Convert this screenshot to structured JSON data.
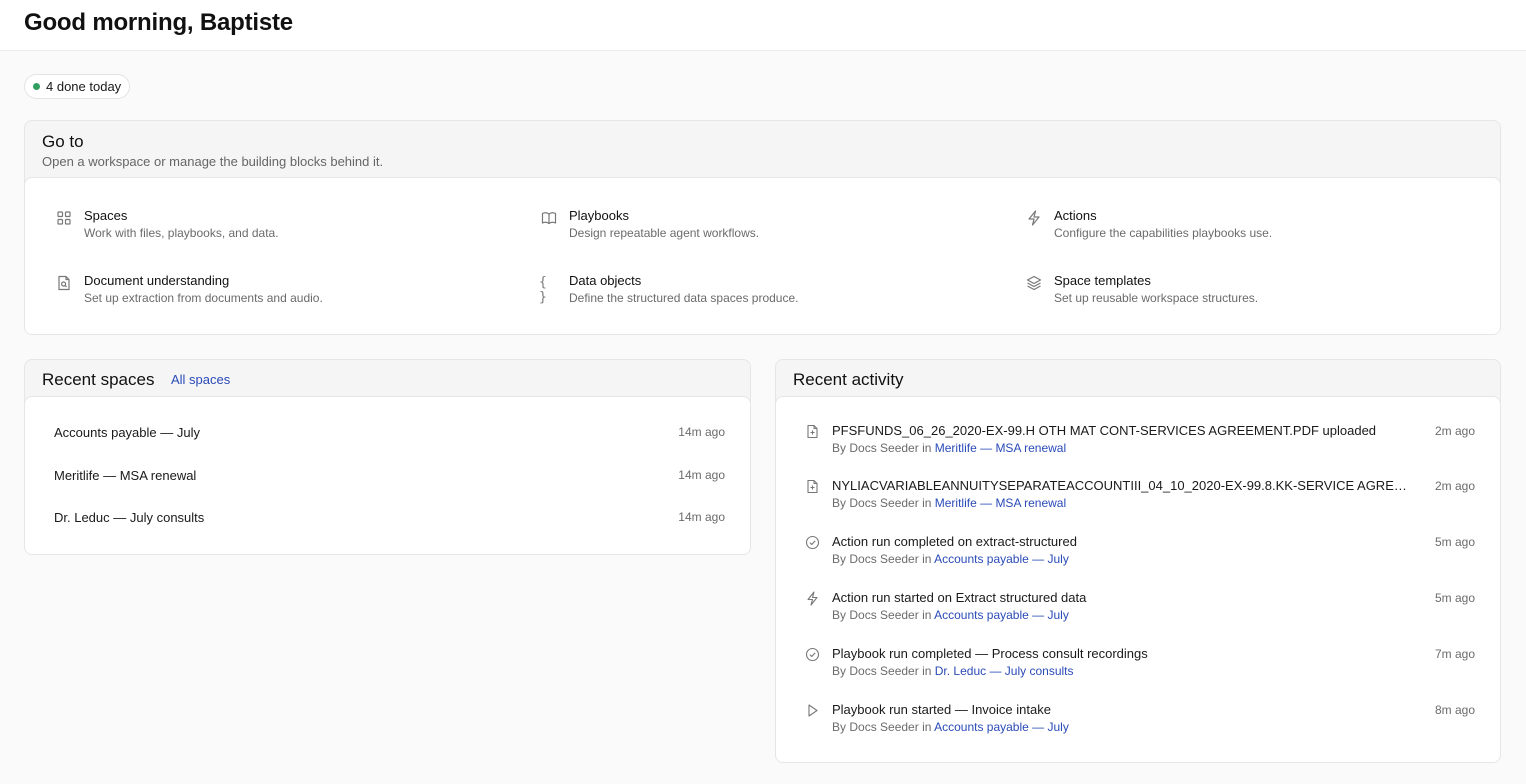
{
  "header": {
    "greeting": "Good morning, Baptiste"
  },
  "status": {
    "text": "4 done today",
    "dot_color": "#2f9e5f"
  },
  "goto": {
    "title": "Go to",
    "subtitle": "Open a workspace or manage the building blocks behind it.",
    "items": [
      {
        "label": "Spaces",
        "description": "Work with files, playbooks, and data.",
        "icon": "grid-icon"
      },
      {
        "label": "Playbooks",
        "description": "Design repeatable agent workflows.",
        "icon": "book-icon"
      },
      {
        "label": "Actions",
        "description": "Configure the capabilities playbooks use.",
        "icon": "lightning-icon"
      },
      {
        "label": "Document understanding",
        "description": "Set up extraction from documents and audio.",
        "icon": "document-search-icon"
      },
      {
        "label": "Data objects",
        "description": "Define the structured data spaces produce.",
        "icon": "braces-icon",
        "glyph": "{ }"
      },
      {
        "label": "Space templates",
        "description": "Set up reusable workspace structures.",
        "icon": "layers-icon"
      }
    ]
  },
  "recent_spaces": {
    "title": "Recent spaces",
    "all_link": "All spaces",
    "items": [
      {
        "name": "Accounts payable — July",
        "time": "14m ago"
      },
      {
        "name": "Meritlife — MSA renewal",
        "time": "14m ago"
      },
      {
        "name": "Dr. Leduc — July consults",
        "time": "14m ago"
      }
    ]
  },
  "recent_activity": {
    "title": "Recent activity",
    "by_prefix": "By",
    "in_word": "in",
    "items": [
      {
        "icon": "file-icon",
        "title": "PFSFUNDS_06_26_2020-EX-99.H OTH MAT CONT-SERVICES AGREEMENT.PDF uploaded",
        "author": "Docs Seeder",
        "space": "Meritlife — MSA renewal",
        "time": "2m ago"
      },
      {
        "icon": "file-icon",
        "title": "NYLIACVARIABLEANNUITYSEPARATEACCOUNTIII_04_10_2020-EX-99.8.KK-SERVICE AGREEMENT.PDF uploaded",
        "author": "Docs Seeder",
        "space": "Meritlife — MSA renewal",
        "time": "2m ago"
      },
      {
        "icon": "check-circle-icon",
        "title": "Action run completed on extract-structured",
        "author": "Docs Seeder",
        "space": "Accounts payable — July",
        "time": "5m ago"
      },
      {
        "icon": "lightning-icon",
        "title": "Action run started on Extract structured data",
        "author": "Docs Seeder",
        "space": "Accounts payable — July",
        "time": "5m ago"
      },
      {
        "icon": "check-circle-icon",
        "title": "Playbook run completed — Process consult recordings",
        "author": "Docs Seeder",
        "space": "Dr. Leduc — July consults",
        "time": "7m ago"
      },
      {
        "icon": "play-icon",
        "title": "Playbook run started — Invoice intake",
        "author": "Docs Seeder",
        "space": "Accounts payable — July",
        "time": "8m ago"
      }
    ]
  },
  "colors": {
    "link": "#2a4bb8",
    "muted": "#6b6b6b",
    "background": "#fafafa"
  }
}
